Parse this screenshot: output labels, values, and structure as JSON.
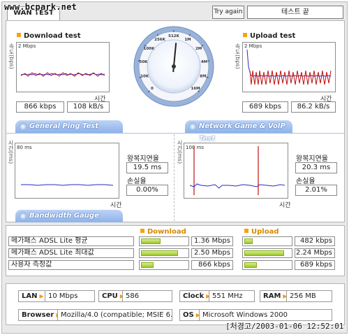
{
  "watermark": "www.bcpark.net",
  "tab": {
    "label": "WAN TEST"
  },
  "try_again": "Try again",
  "status": "테스트 끝",
  "download": {
    "title": "Download test",
    "ylabel": "속도(bps)",
    "scale": "2 Mbps",
    "xlabel": "시간",
    "kbps": "866 kbps",
    "kBs": "108 kB/s"
  },
  "upload": {
    "title": "Upload test",
    "ylabel": "속도(bps)",
    "scale": "2 Mbps",
    "xlabel": "시간",
    "kbps": "689 kbps",
    "kBs": "86.2 kB/s"
  },
  "gauge": {
    "ticks": [
      "0",
      "10K",
      "50K",
      "100K",
      "256K",
      "512K",
      "1M",
      "2M",
      "4M",
      "8M",
      "16M"
    ],
    "needle_fraction": 0.52
  },
  "ping": {
    "header": "General Ping Test",
    "ylabel": "시간(ms)",
    "scale": "80 ms",
    "xlabel": "시간",
    "rtt_label": "왕복지연율",
    "rtt": "19.5 ms",
    "loss_label": "손실율",
    "loss": "0.00%"
  },
  "voip": {
    "header": "Network Game & VoIP Test",
    "ylabel": "시간(ms)",
    "scale": "100 ms",
    "xlabel": "시간",
    "rtt_label": "왕복지연율",
    "rtt": "20.3 ms",
    "loss_label": "손실율",
    "loss": "2.01%"
  },
  "bandwidth": {
    "header": "Bandwidth Gauge",
    "download_head": "Download",
    "upload_head": "Upload",
    "rows": [
      {
        "label": "메가패스 ADSL Lite 평균",
        "down": "1.36 Mbps",
        "down_fill": 0.43,
        "up": "482 kbps",
        "up_fill": 0.18
      },
      {
        "label": "메가패스 ADSL Lite 최대값",
        "down": "2.50 Mbps",
        "down_fill": 0.8,
        "up": "2.24 Mbps",
        "up_fill": 0.87
      },
      {
        "label": "사용자 측정값",
        "down": "866 kbps",
        "down_fill": 0.28,
        "up": "689 kbps",
        "up_fill": 0.27
      }
    ]
  },
  "system": {
    "lan_key": "LAN",
    "lan": "10 Mbps",
    "cpu_key": "CPU",
    "cpu": "586",
    "clock_key": "Clock",
    "clock": "551 MHz",
    "ram_key": "RAM",
    "ram": "256 MB",
    "browser_key": "Browser",
    "browser": "Mozilla/4.0 (compatible; MSIE 6.0",
    "os_key": "OS",
    "os": "Microsoft Windows 2000"
  },
  "timestamp": "[처경고/2003-01-06 12:52:01",
  "colors": {
    "accent": "#f5a313",
    "header_blue": "#8fb2e8",
    "bar_green": "#9cc629",
    "line_blue": "#2a2ac8",
    "line_red": "#c01010"
  }
}
